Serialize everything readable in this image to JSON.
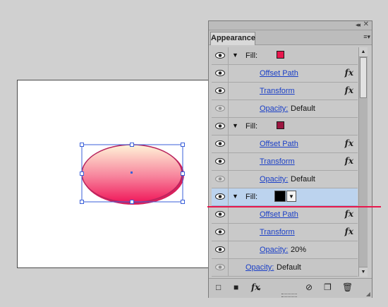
{
  "panel": {
    "tab_label": "Appearance",
    "collapse_glyph": "◂◂",
    "close_glyph": "✕",
    "menu_glyph": "≡▾",
    "rows": [
      {
        "kind": "fill",
        "label": "Fill:",
        "swatch": "#e8174d",
        "visible": true
      },
      {
        "kind": "effect",
        "label": "Offset Path",
        "fx": "fx",
        "visible": true
      },
      {
        "kind": "effect",
        "label": "Transform",
        "fx": "fx",
        "visible": true
      },
      {
        "kind": "opacity",
        "label": "Opacity:",
        "value": "Default",
        "visible": false
      },
      {
        "kind": "fill",
        "label": "Fill:",
        "swatch": "#9c1640",
        "visible": true
      },
      {
        "kind": "effect",
        "label": "Offset Path",
        "fx": "fx",
        "visible": true
      },
      {
        "kind": "effect",
        "label": "Transform",
        "fx": "fx",
        "visible": true
      },
      {
        "kind": "opacity",
        "label": "Opacity:",
        "value": "Default",
        "visible": false
      },
      {
        "kind": "fill-selected",
        "label": "Fill:",
        "swatch": "#000000",
        "dropdown_glyph": "▼",
        "visible": true
      },
      {
        "kind": "effect",
        "label": "Offset Path",
        "fx": "fx",
        "visible": true
      },
      {
        "kind": "effect",
        "label": "Transform",
        "fx": "fx",
        "visible": true
      },
      {
        "kind": "opacity",
        "label": "Opacity:",
        "value": "20%",
        "visible": true
      },
      {
        "kind": "opacity-top",
        "label": "Opacity:",
        "value": "Default",
        "visible": false
      }
    ],
    "bottom_bar": {
      "new_stroke_icon": "□",
      "new_fill_icon": "■",
      "fx_label": "fx",
      "clear_icon": "⊘",
      "duplicate_icon": "❐",
      "delete_icon": "🗑"
    }
  },
  "colors": {
    "accent_line": "#e8174d",
    "selection_row": "#bcd3ee",
    "link": "#1a3fc7",
    "ellipse_top": "#fff4d8",
    "ellipse_bottom": "#f0185a",
    "ellipse_stroke": "#b8245e",
    "selection_box": "#3a5fd9"
  }
}
